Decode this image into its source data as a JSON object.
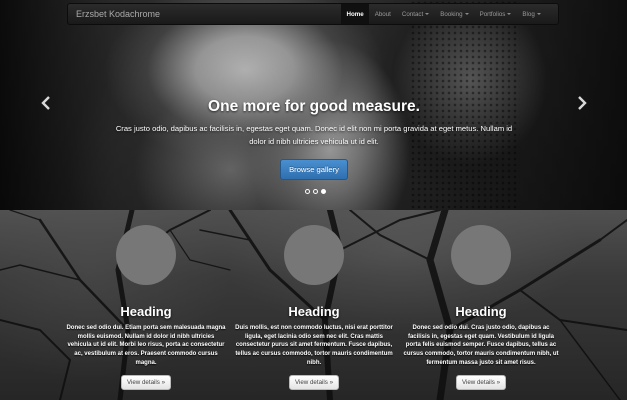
{
  "navbar": {
    "brand": "Erzsbet Kodachrome",
    "items": [
      {
        "label": "Home",
        "active": true,
        "dropdown": false
      },
      {
        "label": "About",
        "active": false,
        "dropdown": false
      },
      {
        "label": "Contact",
        "active": false,
        "dropdown": true
      },
      {
        "label": "Booking",
        "active": false,
        "dropdown": true
      },
      {
        "label": "Portfolios",
        "active": false,
        "dropdown": true
      },
      {
        "label": "Blog",
        "active": false,
        "dropdown": true
      }
    ]
  },
  "carousel": {
    "title": "One more for good measure.",
    "text": "Cras justo odio, dapibus ac facilisis in, egestas eget quam. Donec id elit non mi porta gravida at eget metus. Nullam id dolor id nibh ultricies vehicula ut id elit.",
    "button_label": "Browse gallery",
    "indicator_count": 3,
    "active_indicator": 3,
    "prev_icon": "chevron-left-icon",
    "next_icon": "chevron-right-icon"
  },
  "columns": [
    {
      "heading": "Heading",
      "text": "Donec sed odio dui. Etiam porta sem malesuada magna mollis euismod. Nullam id dolor id nibh ultricies vehicula ut id elit. Morbi leo risus, porta ac consectetur ac, vestibulum at eros. Praesent commodo cursus magna.",
      "button_label": "View details »"
    },
    {
      "heading": "Heading",
      "text": "Duis mollis, est non commodo luctus, nisi erat porttitor ligula, eget lacinia odio sem nec elit. Cras mattis consectetur purus sit amet fermentum. Fusce dapibus, tellus ac cursus commodo, tortor mauris condimentum nibh.",
      "button_label": "View details »"
    },
    {
      "heading": "Heading",
      "text": "Donec sed odio dui. Cras justo odio, dapibus ac facilisis in, egestas eget quam. Vestibulum id ligula porta felis euismod semper. Fusce dapibus, tellus ac cursus commodo, tortor mauris condimentum nibh, ut fermentum massa justo sit amet risus.",
      "button_label": "View details »"
    }
  ],
  "colors": {
    "primary_button": "#3479bd",
    "navbar": "#222222",
    "circle_placeholder": "#777777"
  }
}
